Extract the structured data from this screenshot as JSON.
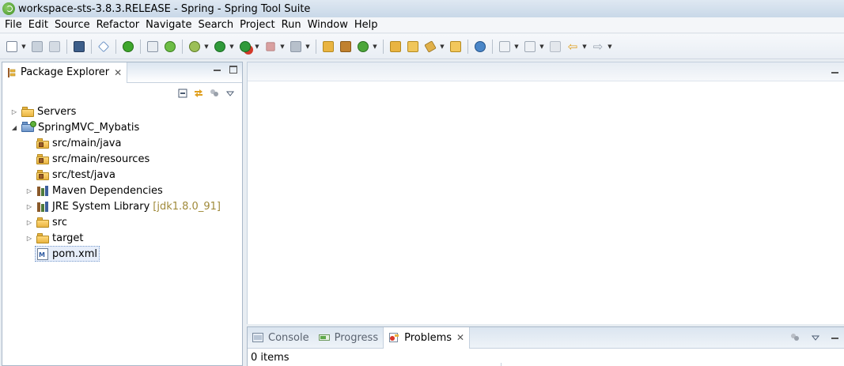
{
  "window": {
    "title": "workspace-sts-3.8.3.RELEASE - Spring - Spring Tool Suite"
  },
  "menu": [
    "File",
    "Edit",
    "Source",
    "Refactor",
    "Navigate",
    "Search",
    "Project",
    "Run",
    "Window",
    "Help"
  ],
  "package_explorer": {
    "tab_label": "Package Explorer",
    "tree": [
      {
        "label": "Servers",
        "type": "folder",
        "level": 0,
        "expandable": true,
        "expanded": false
      },
      {
        "label": "SpringMVC_Mybatis",
        "type": "project",
        "level": 0,
        "expandable": true,
        "expanded": true
      },
      {
        "label": "src/main/java",
        "type": "package-root",
        "level": 1,
        "expandable": false
      },
      {
        "label": "src/main/resources",
        "type": "package-root",
        "level": 1,
        "expandable": false
      },
      {
        "label": "src/test/java",
        "type": "package-root",
        "level": 1,
        "expandable": false
      },
      {
        "label": "Maven Dependencies",
        "type": "library",
        "level": 1,
        "expandable": true,
        "expanded": false
      },
      {
        "label": "JRE System Library",
        "decoration": "[jdk1.8.0_91]",
        "type": "library",
        "level": 1,
        "expandable": true,
        "expanded": false
      },
      {
        "label": "src",
        "type": "folder",
        "level": 1,
        "expandable": true,
        "expanded": false
      },
      {
        "label": "target",
        "type": "folder",
        "level": 1,
        "expandable": true,
        "expanded": false
      },
      {
        "label": "pom.xml",
        "type": "xml-file",
        "level": 1,
        "expandable": false,
        "selected": true
      }
    ]
  },
  "bottom_panel": {
    "tabs": [
      {
        "label": "Console",
        "active": false
      },
      {
        "label": "Progress",
        "active": false
      },
      {
        "label": "Problems",
        "active": true
      }
    ],
    "status": "0 items"
  },
  "colors": {
    "accent": "#3e6aa4",
    "folder": "#e9b441",
    "selection": "#e7eefa"
  }
}
